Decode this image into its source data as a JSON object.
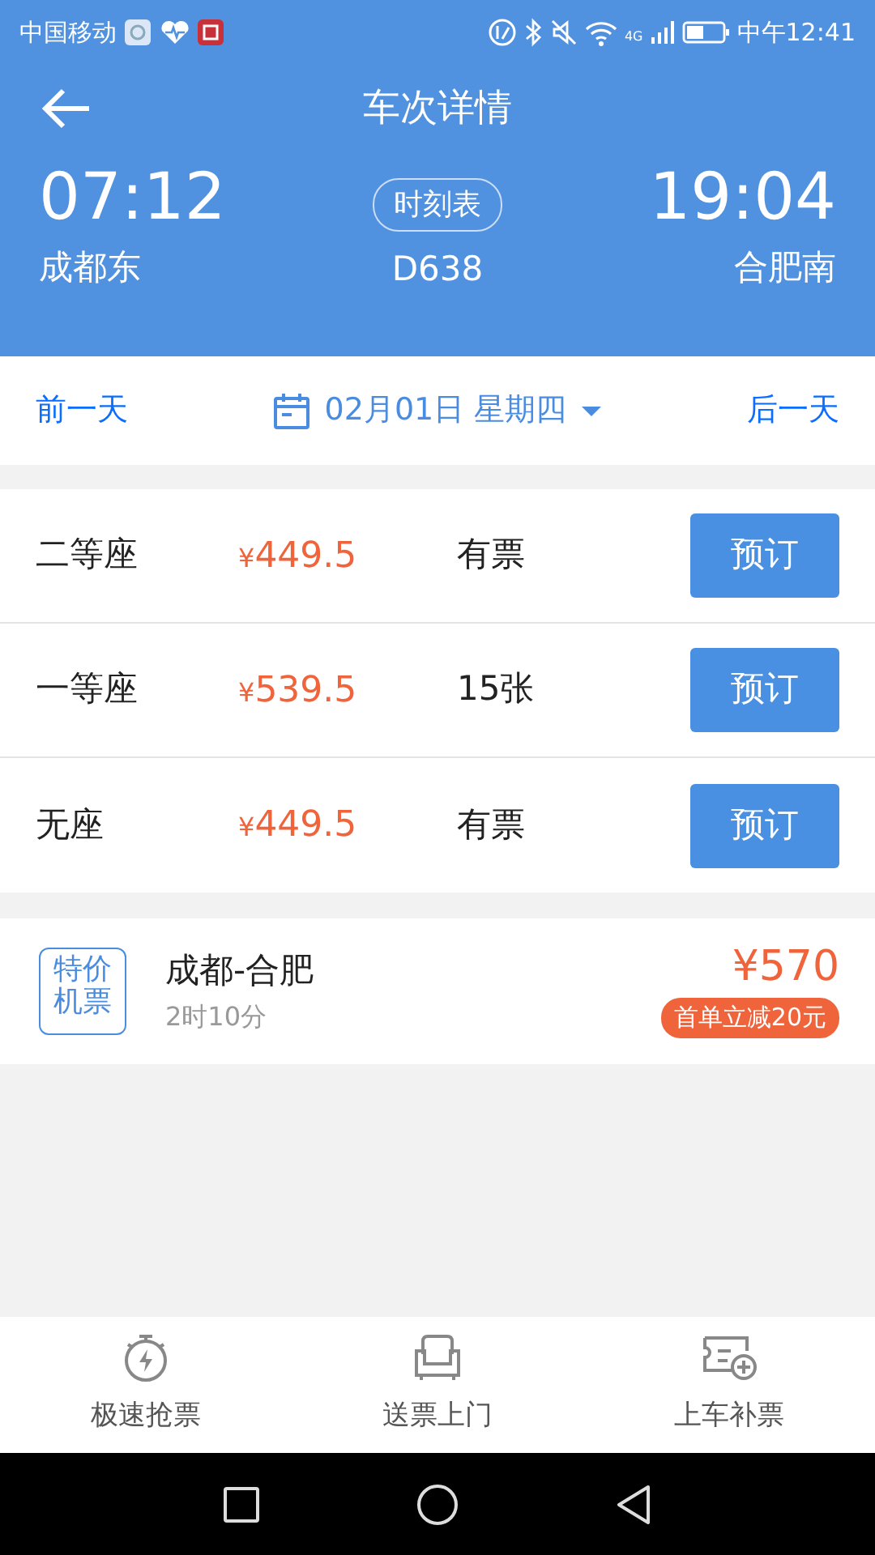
{
  "status_bar": {
    "carrier": "中国移动",
    "network": "4G",
    "time": "中午12:41"
  },
  "header": {
    "title": "车次详情",
    "depart_time": "07:12",
    "depart_station": "成都东",
    "timetable_button": "时刻表",
    "train_no": "D638",
    "arrive_time": "19:04",
    "arrive_station": "合肥南"
  },
  "date_bar": {
    "prev": "前一天",
    "date": "02月01日 星期四",
    "next": "后一天"
  },
  "seats": [
    {
      "name": "二等座",
      "currency": "¥",
      "price": "449.5",
      "availability": "有票",
      "button": "预订"
    },
    {
      "name": "一等座",
      "currency": "¥",
      "price": "539.5",
      "availability": "15张",
      "button": "预订"
    },
    {
      "name": "无座",
      "currency": "¥",
      "price": "449.5",
      "availability": "有票",
      "button": "预订"
    }
  ],
  "flight": {
    "badge": "特价机票",
    "route": "成都-合肥",
    "duration": "2时10分",
    "price": "¥570",
    "promo": "首单立减20元"
  },
  "bottom_nav": [
    {
      "kind": "stopwatch",
      "label": "极速抢票"
    },
    {
      "kind": "sofa",
      "label": "送票上门"
    },
    {
      "kind": "ticket",
      "label": "上车补票"
    }
  ]
}
